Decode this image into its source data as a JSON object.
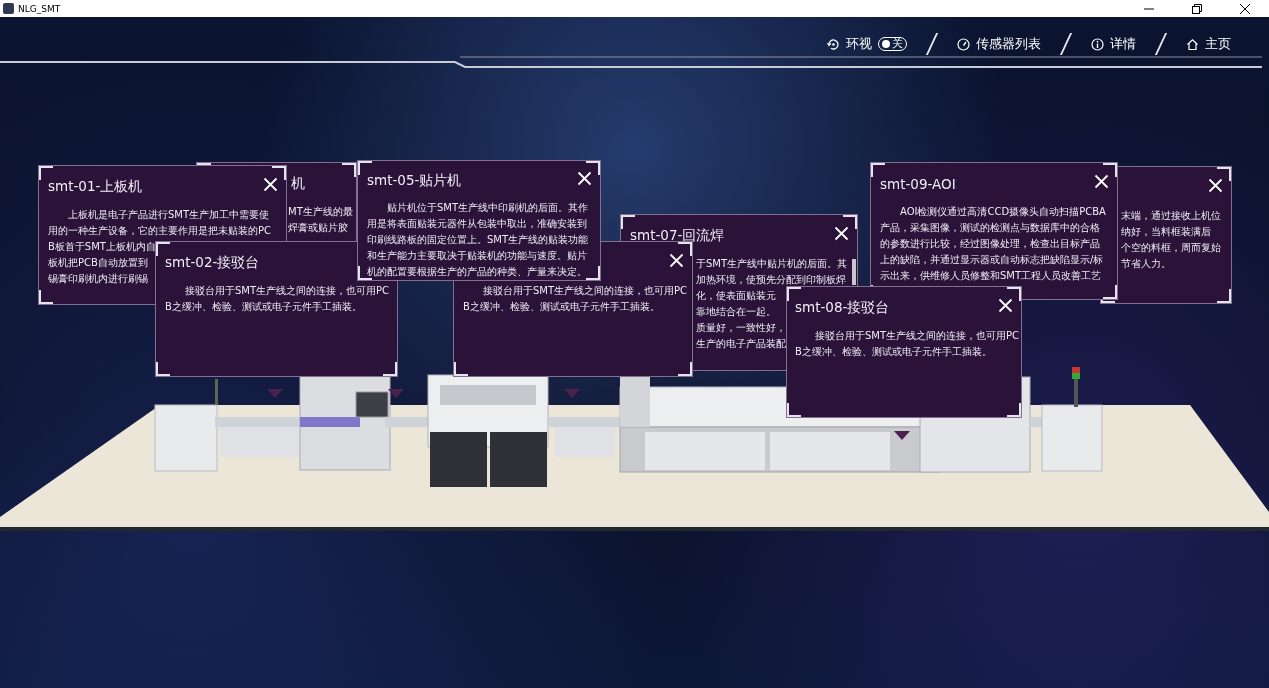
{
  "window": {
    "title": "NLG_SMT"
  },
  "nav": [
    {
      "kind": "toggle",
      "label": "环视",
      "toggle": {
        "on": false,
        "text": "关"
      }
    },
    {
      "kind": "link",
      "label": "传感器列表"
    },
    {
      "kind": "link",
      "label": "详情"
    },
    {
      "kind": "link",
      "label": "主页"
    }
  ],
  "panels": [
    {
      "title": "smt-01-上板机",
      "close": true,
      "lines": [
        "上板机是电子产品进行SMT生产加工中需要使",
        "用的一种生产设备，它的主要作用是把未贴装的PC",
        "B板首于SMT上板机内自",
        "板机把PCB自动放置到",
        "锡膏印刷机内进行刷锡"
      ]
    },
    {
      "title": "smt-02-接驳台",
      "close": false,
      "lines": [
        "接驳台用于SMT生产线之间的连接，也可用PC",
        "B之缓冲、检验、测试或电子元件手工插装。"
      ]
    },
    {
      "title": "机",
      "close": false,
      "lines": [
        "MT生产线的最",
        "焊膏或贴片胶"
      ]
    },
    {
      "title": "smt-05-贴片机",
      "close": true,
      "lines": [
        "贴片机位于SMT生产线中印刷机的后面。其作",
        "用是将表面贴装元器件从包装中取出，准确安装到",
        "印刷线路板的固定位置上。SMT生产线的贴装功能",
        "和生产能力主要取决于贴装机的功能与速度。贴片",
        "机的配置要根据生产的产品的种类、产量来决定。"
      ]
    },
    {
      "close": true,
      "lines": [
        "接驳台用于SMT生产线之间的连接，也可用PC",
        "B之缓冲、检验、测试或电子元件手工插装。"
      ]
    },
    {
      "title": "smt-07-回流焊",
      "close": true,
      "lines": [
        "于SMT生产线中贴片机的后面。其",
        "加热环境，使预先分配到印制板焊",
        "化，使表面贴装元",
        "靠地结合在一起。",
        "质量好，一致性好，",
        "生产的电子产品装配"
      ]
    },
    {
      "title": "smt-08-接驳台",
      "close": true,
      "lines": [
        "接驳台用于SMT生产线之间的连接，也可用PC",
        "B之缓冲、检验、测试或电子元件手工插装。"
      ]
    },
    {
      "title": "smt-09-AOI",
      "close": true,
      "lines": [
        "AOI检测仪通过高清CCD摄像头自动扫描PCBA",
        "产品，采集图像，测试的检测点与数据库中的合格",
        "的参数进行比较，经过图像处理，检查出目标产品",
        "上的缺陷，并通过显示器或自动标志把缺陷显示/标",
        "示出来，供维修人员修整和SMT工程人员改善工艺"
      ]
    },
    {
      "close": true,
      "lines": [
        "末端，通过接收上机位",
        "纳好，当料框装满后",
        "个空的料框，周而复始",
        "节省人力。"
      ]
    }
  ]
}
